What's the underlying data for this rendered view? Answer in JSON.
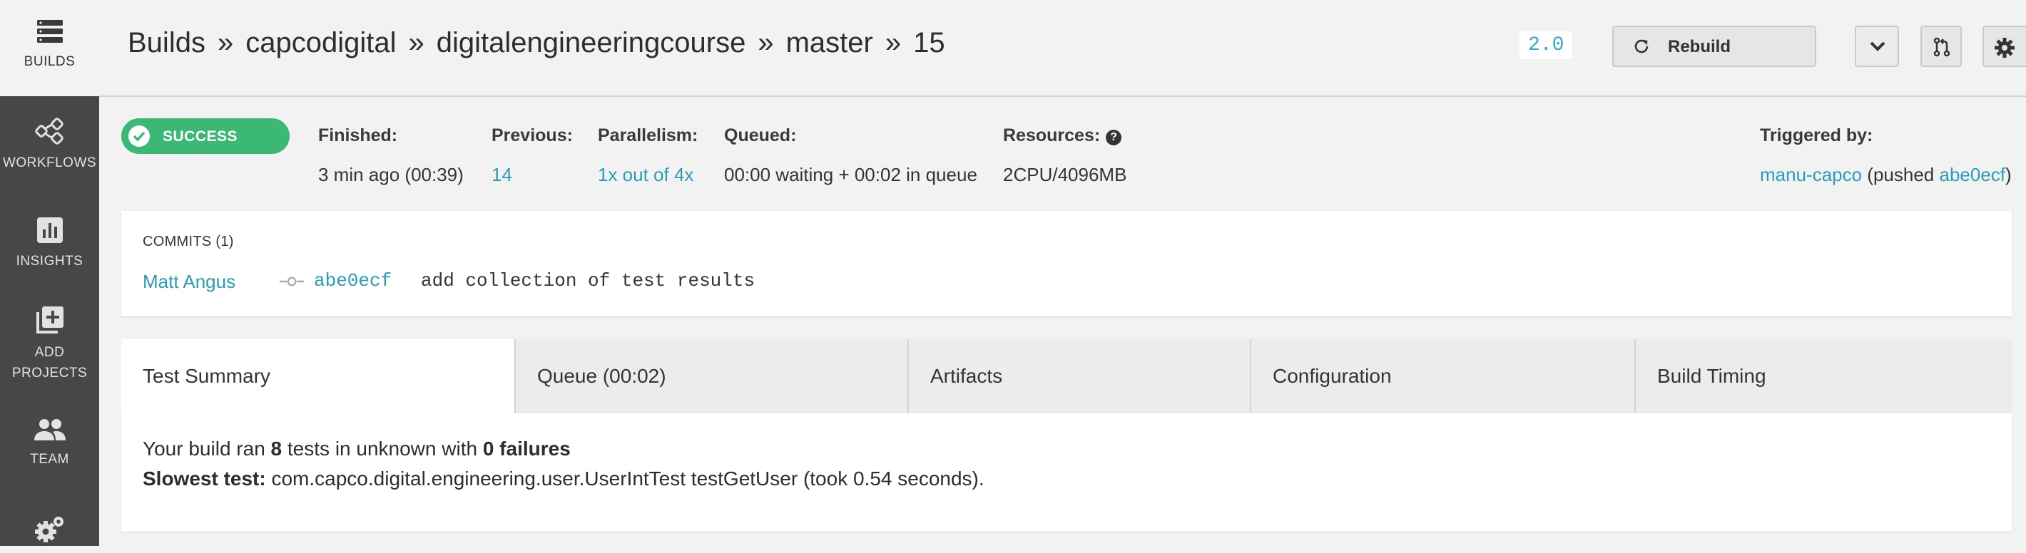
{
  "sidebar": {
    "items": [
      {
        "label": "BUILDS",
        "icon": "builds-icon"
      },
      {
        "label": "WORKFLOWS",
        "icon": "workflows-icon"
      },
      {
        "label": "INSIGHTS",
        "icon": "insights-icon"
      },
      {
        "label_line1": "ADD",
        "label_line2": "PROJECTS",
        "icon": "add-projects-icon"
      },
      {
        "label": "TEAM",
        "icon": "team-icon"
      },
      {
        "icon": "settings-icon"
      }
    ]
  },
  "header": {
    "breadcrumb": [
      "Builds",
      "capcodigital",
      "digitalengineeringcourse",
      "master",
      "15"
    ],
    "separator": "»",
    "version": "2.0",
    "rebuild_label": "Rebuild"
  },
  "status": {
    "label": "SUCCESS",
    "color": "#3bb874"
  },
  "meta": {
    "finished_label": "Finished:",
    "finished_value": "3 min ago (00:39)",
    "previous_label": "Previous:",
    "previous_value": "14",
    "parallelism_label": "Parallelism:",
    "parallelism_value": "1x out of 4x",
    "queued_label": "Queued:",
    "queued_value": "00:00 waiting + 00:02 in queue",
    "resources_label": "Resources:",
    "resources_help": "?",
    "resources_value": "2CPU/4096MB",
    "triggered_label": "Triggered by:",
    "triggered_user": "manu-capco",
    "triggered_mid": " (pushed ",
    "triggered_sha": "abe0ecf",
    "triggered_end": ")"
  },
  "commits": {
    "heading": "COMMITS (1)",
    "items": [
      {
        "author": "Matt Angus",
        "sha": "abe0ecf",
        "message": "add collection of test results"
      }
    ]
  },
  "tabs": [
    {
      "label": "Test Summary",
      "active": true
    },
    {
      "label": "Queue (00:02)"
    },
    {
      "label": "Artifacts"
    },
    {
      "label": "Configuration"
    },
    {
      "label": "Build Timing"
    }
  ],
  "summary": {
    "p1_a": "Your build ran ",
    "tests_count": "8",
    "p1_b": " tests in unknown with ",
    "failures": "0 failures",
    "slowest_label": "Slowest test:",
    "slowest_value": " com.capco.digital.engineering.user.UserIntTest testGetUser (took 0.54 seconds)."
  },
  "colors": {
    "sidebar_bg": "#474747",
    "link": "#2a9cb6",
    "success": "#3bb874",
    "version": "#35a8d2"
  }
}
